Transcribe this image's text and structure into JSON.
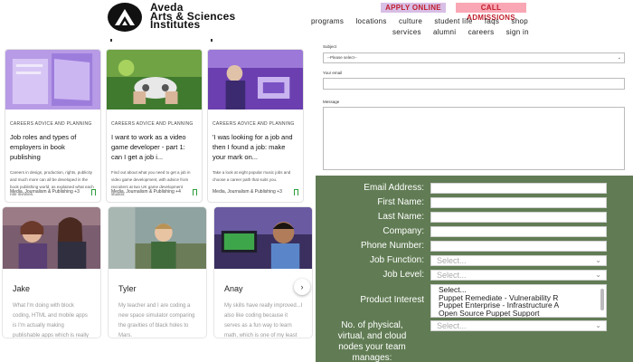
{
  "header": {
    "logo_lines": [
      "Aveda",
      "Arts & Sciences",
      "Institutes"
    ],
    "apply_label": "APPLY ONLINE",
    "call_label": "CALL ADMISSIONS",
    "nav_row1": [
      "programs",
      "locations",
      "culture",
      "student life",
      "faqs",
      "shop"
    ],
    "nav_row2": [
      "services",
      "alumni",
      "careers",
      "sign in"
    ]
  },
  "articles": [
    {
      "category": "CAREERS ADVICE AND PLANNING",
      "title": "Job roles and types of employers in book publishing",
      "desc": "Careers in design, production, rights, publicity and much more can all be developed in the book publishing world, as explained what each role involves.",
      "tags": "Media, Journalism & Publishing +3"
    },
    {
      "category": "CAREERS ADVICE AND PLANNING",
      "title": "I want to work as a video game developer - part 1: can I get a job i...",
      "desc": "Find out about what you need to get a job in video game development, with advice from recruiters at two UK game development studios.",
      "tags": "Media, Journalism & Publishing +4"
    },
    {
      "category": "CAREERS ADVICE AND PLANNING",
      "title": "'I was looking for a job and then I found a job: make your mark on...",
      "desc": "Take a look at eight popular music jobs and choose a career path that suits you.",
      "tags": "Media, Journalism & Publishing +3"
    }
  ],
  "profiles": [
    {
      "name": "Jake",
      "text": "What I'm doing with block coding, HTML and mobile apps is I'm actually making publishable apps which is really cool!"
    },
    {
      "name": "Tyler",
      "text": "My teacher and I are coding a new space simulator comparing the gravities of black holes to Mars."
    },
    {
      "name": "Anay",
      "text": "My skills have really improved...I also like coding because it serves as a fun way to learn math, which is one of my least favorite subjects."
    }
  ],
  "next_arrow": "›",
  "contact_form": {
    "subject_label": "Subject",
    "subject_value": "--Please select--",
    "email_label": "Your email",
    "message_label": "Message"
  },
  "lead_form": {
    "labels": [
      "Email Address:",
      "First Name:",
      "Last Name:",
      "Company:",
      "Phone Number:",
      "Job Function:",
      "Job Level:"
    ],
    "select_placeholder": "Select...",
    "product_interest_label": "Product Interest",
    "product_options": [
      "Select...",
      "Puppet Remediate - Vulnerability R",
      "Puppet Enterprise - Infrastructure A",
      "Open Source Puppet Support"
    ],
    "nodes_label_lines": [
      "No. of physical,",
      "virtual, and cloud",
      "nodes your team",
      "manages:"
    ]
  },
  "colors": {
    "form_bg": "#617c54",
    "bookmark": "#2a9d3b",
    "accent_red": "#c11d2b"
  }
}
